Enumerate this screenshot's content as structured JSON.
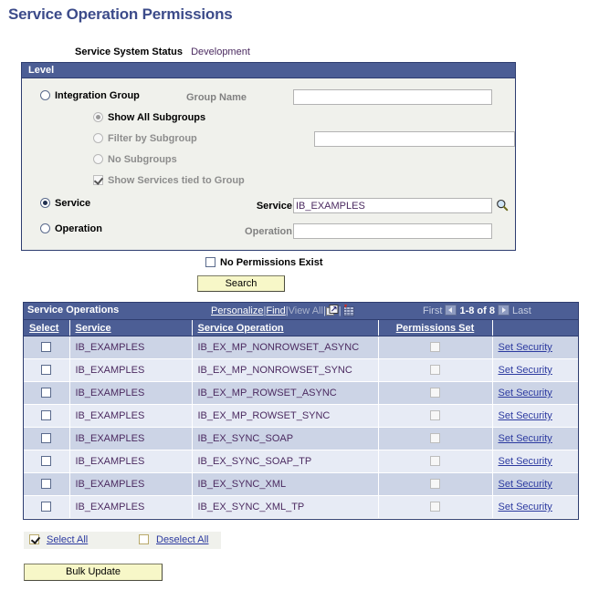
{
  "page": {
    "title": "Service Operation Permissions"
  },
  "system_status": {
    "label": "Service System Status",
    "value": "Development"
  },
  "level_panel": {
    "header": "Level",
    "integration_group": {
      "label": "Integration Group",
      "selected": false,
      "group_name_label": "Group Name",
      "group_name_value": "",
      "subgroup_options": [
        {
          "label": "Show All Subgroups",
          "selected": true,
          "disabled": true
        },
        {
          "label": "Filter by Subgroup",
          "selected": false,
          "disabled": true
        },
        {
          "label": "No Subgroups",
          "selected": false,
          "disabled": true
        }
      ],
      "filter_subgroup_value": "",
      "show_services_tied": {
        "label": "Show Services tied to Group",
        "checked": true,
        "disabled": true
      }
    },
    "service": {
      "label": "Service",
      "selected": true,
      "field_label": "Service",
      "value": "IB_EXAMPLES",
      "lookup_icon": "magnifier-icon"
    },
    "operation": {
      "label": "Operation",
      "selected": false,
      "field_label": "Operation",
      "value": ""
    }
  },
  "filters": {
    "no_permissions_exist": {
      "label": "No Permissions Exist",
      "checked": false
    },
    "search_label": "Search"
  },
  "grid": {
    "title": "Service Operations",
    "tools": {
      "personalize": "Personalize",
      "find": "Find",
      "view_all": "View All",
      "separator": "|",
      "zoom_icon": "expand-grid-icon",
      "download_icon": "download-spreadsheet-icon"
    },
    "nav": {
      "first": "First",
      "range": "1-8 of 8",
      "last": "Last",
      "prev_icon": "prev-page-icon",
      "next_icon": "next-page-icon"
    },
    "columns": [
      {
        "key": "select",
        "label": "Select"
      },
      {
        "key": "service",
        "label": "Service"
      },
      {
        "key": "service_operation",
        "label": "Service Operation"
      },
      {
        "key": "permissions_set",
        "label": "Permissions Set"
      },
      {
        "key": "action",
        "label": ""
      }
    ],
    "rows": [
      {
        "select": false,
        "service": "IB_EXAMPLES",
        "service_operation": "IB_EX_MP_NONROWSET_ASYNC",
        "permissions_set": false,
        "action": "Set Security"
      },
      {
        "select": false,
        "service": "IB_EXAMPLES",
        "service_operation": "IB_EX_MP_NONROWSET_SYNC",
        "permissions_set": false,
        "action": "Set Security"
      },
      {
        "select": false,
        "service": "IB_EXAMPLES",
        "service_operation": "IB_EX_MP_ROWSET_ASYNC",
        "permissions_set": false,
        "action": "Set Security"
      },
      {
        "select": false,
        "service": "IB_EXAMPLES",
        "service_operation": "IB_EX_MP_ROWSET_SYNC",
        "permissions_set": false,
        "action": "Set Security"
      },
      {
        "select": false,
        "service": "IB_EXAMPLES",
        "service_operation": "IB_EX_SYNC_SOAP",
        "permissions_set": false,
        "action": "Set Security"
      },
      {
        "select": false,
        "service": "IB_EXAMPLES",
        "service_operation": "IB_EX_SYNC_SOAP_TP",
        "permissions_set": false,
        "action": "Set Security"
      },
      {
        "select": false,
        "service": "IB_EXAMPLES",
        "service_operation": "IB_EX_SYNC_XML",
        "permissions_set": false,
        "action": "Set Security"
      },
      {
        "select": false,
        "service": "IB_EXAMPLES",
        "service_operation": "IB_EX_SYNC_XML_TP",
        "permissions_set": false,
        "action": "Set Security"
      }
    ]
  },
  "footer": {
    "select_all": {
      "label": "Select All",
      "checked": true
    },
    "deselect_all": {
      "label": "Deselect All",
      "checked": false
    },
    "bulk_update_label": "Bulk Update"
  },
  "colors": {
    "header_blue": "#4c5e95",
    "panel_border": "#2e3d70",
    "panel_bg": "#f0f1ec",
    "title_blue": "#3c4b8a",
    "row_odd": "#ccd4e6",
    "row_even": "#e7ebf5",
    "button_yellow": "#f7f7c8",
    "link_blue": "#2c3aa0",
    "value_purple": "#4b2a60"
  }
}
